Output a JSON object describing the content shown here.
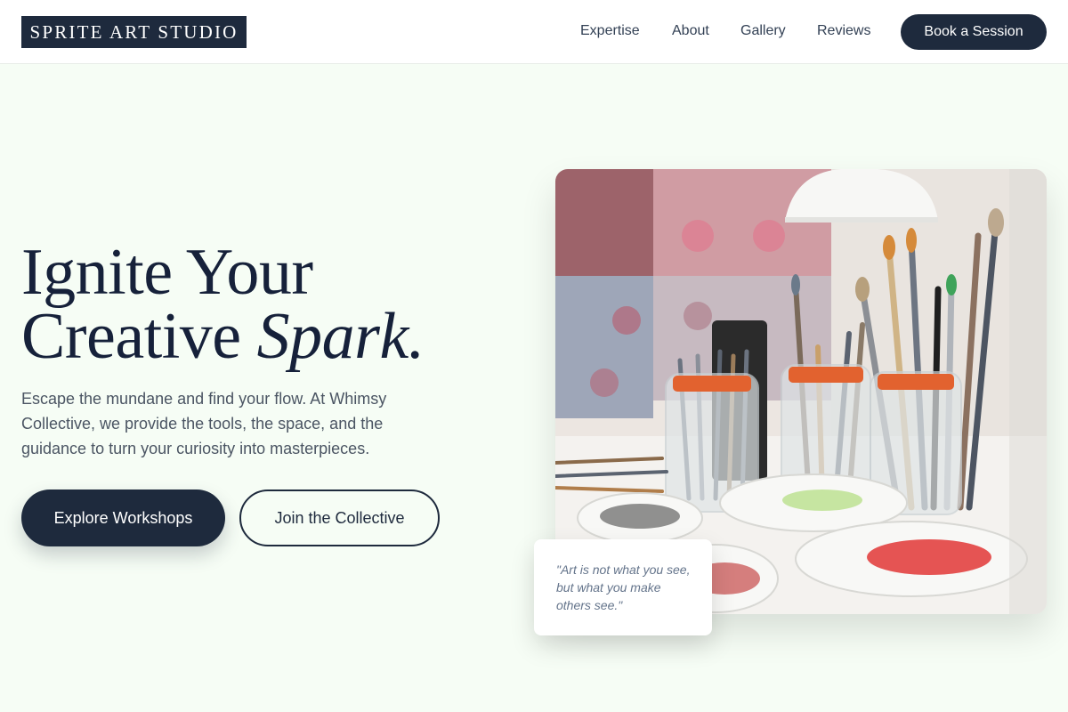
{
  "brand": {
    "logo_text": "SPRITE ART STUDIO"
  },
  "nav": {
    "items": [
      {
        "label": "Expertise"
      },
      {
        "label": "About"
      },
      {
        "label": "Gallery"
      },
      {
        "label": "Reviews"
      }
    ],
    "cta_label": "Book a Session"
  },
  "hero": {
    "title_line1": "Ignite Your",
    "title_line2_plain": "Creative ",
    "title_line2_em": "Spark.",
    "description": "Escape the mundane and find your flow. At Whimsy Collective, we provide the tools, the space, and the guidance to turn your curiosity into masterpieces.",
    "primary_button": "Explore Workshops",
    "secondary_button": "Join the Collective",
    "quote": "\"Art is not what you see, but what you make others see.\""
  },
  "colors": {
    "background": "#f6fdf5",
    "brand_dark": "#1e2a3d",
    "text_muted": "#4b5563"
  },
  "icons": [
    "paintbrush-jars-photo"
  ]
}
